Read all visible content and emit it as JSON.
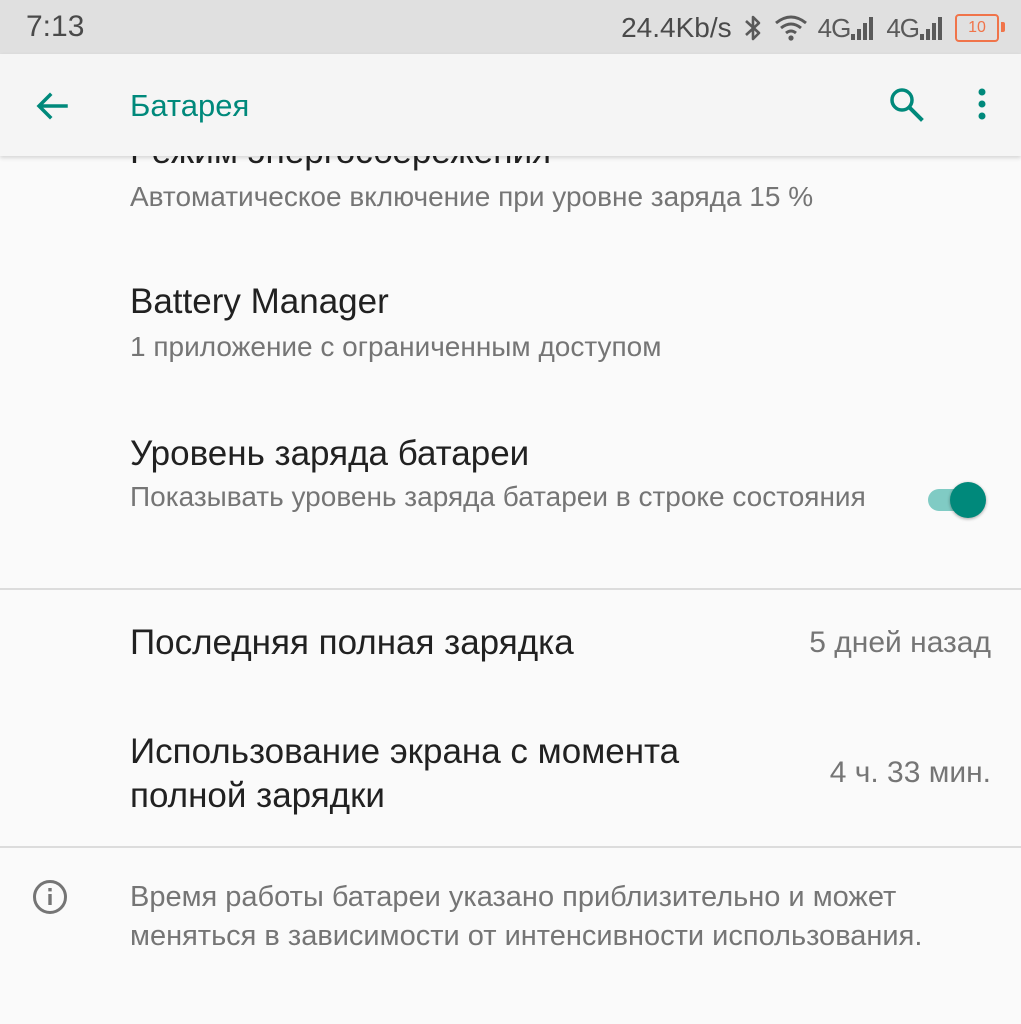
{
  "status_bar": {
    "time": "7:13",
    "net_speed": "24.4Kb/s",
    "signal1_label": "4G",
    "signal2_label": "4G",
    "battery_level": "10"
  },
  "app_bar": {
    "title": "Батарея",
    "accent_color": "#00897b"
  },
  "preferences": [
    {
      "title": "Режим энергосбережения",
      "summary": "Автоматическое включение при уровне заряда 15 %"
    },
    {
      "title": "Battery Manager",
      "summary": "1 приложение с ограниченным доступом"
    },
    {
      "title": "Уровень заряда батареи",
      "summary": "Показывать уровень заряда батареи в строке состояния",
      "toggle_on": true
    }
  ],
  "stats": [
    {
      "title": "Последняя полная зарядка",
      "value": "5 дней назад"
    },
    {
      "title": "Использование экрана с момента полной зарядки",
      "value": "4 ч. 33 мин."
    }
  ],
  "footer": {
    "text": "Время работы батареи указано приблизительно и может меняться в зависимости от интенсивности использования."
  }
}
